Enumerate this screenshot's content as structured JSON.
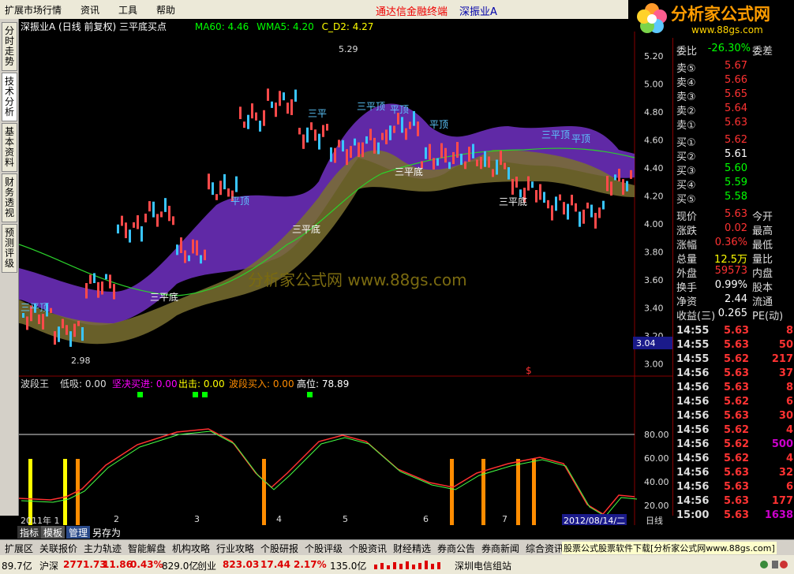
{
  "menubar": {
    "items": [
      "扩展市场行情",
      "资讯",
      "工具",
      "帮助"
    ],
    "highlight1": "通达信金融终端",
    "highlight2": "深振业A"
  },
  "logo": {
    "brand": "分析家公式网",
    "url": "www.88gs.com",
    "sub": "深振业A"
  },
  "sidetabs": [
    "分时走势",
    "技术分析",
    "基本资料",
    "财务透视",
    "预测评级"
  ],
  "chart": {
    "title": "深振业A (日线 前复权) 三平底买点",
    "ma60": "MA60: 4.46",
    "wma5": "WMA5: 4.20",
    "cd2": "C_D2: 4.27",
    "high_label": "5.29",
    "low_label": "2.98",
    "watermark": "分析家公式网 www.88gs.com",
    "labels": [
      "三平顶",
      "平顶",
      "三平底",
      "三平底",
      "三平",
      "平顶",
      "三平顶",
      "平顶",
      "三平底",
      "三平底",
      "三平顶",
      "平顶"
    ],
    "y_axis": [
      "5.20",
      "5.00",
      "4.80",
      "4.60",
      "4.40",
      "4.20",
      "4.00",
      "3.80",
      "3.60",
      "3.40",
      "3.20",
      "3.00"
    ],
    "cursor_price": "3.04",
    "dollar_marker": "$"
  },
  "indicator": {
    "name": "波段王",
    "low": "低吸: 0.00",
    "buy": "坚决买进: 0.00",
    "exit": "出击: 0.00",
    "wave": "波段买入: 0.00",
    "high": "高位: 78.89",
    "y_axis": [
      "80.00",
      "60.00",
      "40.00",
      "20.00"
    ]
  },
  "x_axis": {
    "labels": [
      "2011年 1",
      "2",
      "3",
      "4",
      "5",
      "6",
      "7"
    ],
    "date_badge": "2012/08/14/二",
    "period": "日线"
  },
  "indicator_tabs": [
    "指标",
    "模板",
    "管理",
    "另存为"
  ],
  "quote": {
    "ratio_label": "委比",
    "ratio_value": "-26.30%",
    "ratio_right": "委差",
    "asks": [
      {
        "label": "卖⑤",
        "price": "5.67"
      },
      {
        "label": "卖④",
        "price": "5.66"
      },
      {
        "label": "卖③",
        "price": "5.65"
      },
      {
        "label": "卖②",
        "price": "5.64"
      },
      {
        "label": "卖①",
        "price": "5.63"
      }
    ],
    "bids": [
      {
        "label": "买①",
        "price": "5.62",
        "color": "#ff3232"
      },
      {
        "label": "买②",
        "price": "5.61",
        "color": "#ffffff"
      },
      {
        "label": "买③",
        "price": "5.60",
        "color": "#00ff00"
      },
      {
        "label": "买④",
        "price": "5.59",
        "color": "#00ff00"
      },
      {
        "label": "买⑤",
        "price": "5.58",
        "color": "#00ff00"
      }
    ],
    "stats": [
      {
        "label": "现价",
        "value": "5.63",
        "right": "今开",
        "color": "#ff3232"
      },
      {
        "label": "涨跌",
        "value": "0.02",
        "right": "最高",
        "color": "#ff3232"
      },
      {
        "label": "涨幅",
        "value": "0.36%",
        "right": "最低",
        "color": "#ff3232"
      },
      {
        "label": "总量",
        "value": "12.5万",
        "right": "量比",
        "color": "#ffff00"
      },
      {
        "label": "外盘",
        "value": "59573",
        "right": "内盘",
        "color": "#ff3232"
      },
      {
        "label": "换手",
        "value": "0.99%",
        "right": "股本",
        "color": "#ffffff"
      },
      {
        "label": "净资",
        "value": "2.44",
        "right": "流通",
        "color": "#ffffff"
      },
      {
        "label": "收益(三)",
        "value": "0.265",
        "right": "PE(动)",
        "color": "#ffffff"
      }
    ],
    "ticks": [
      {
        "time": "14:55",
        "price": "5.63",
        "vol": "8",
        "color": "#ff3232"
      },
      {
        "time": "14:55",
        "price": "5.63",
        "vol": "50",
        "color": "#ff3232"
      },
      {
        "time": "14:55",
        "price": "5.62",
        "vol": "217",
        "color": "#ff3232"
      },
      {
        "time": "14:56",
        "price": "5.63",
        "vol": "37",
        "color": "#ff3232"
      },
      {
        "time": "14:56",
        "price": "5.63",
        "vol": "8",
        "color": "#ff3232"
      },
      {
        "time": "14:56",
        "price": "5.62",
        "vol": "6",
        "color": "#ff3232"
      },
      {
        "time": "14:56",
        "price": "5.63",
        "vol": "30",
        "color": "#ff3232"
      },
      {
        "time": "14:56",
        "price": "5.62",
        "vol": "4",
        "color": "#ff3232"
      },
      {
        "time": "14:56",
        "price": "5.62",
        "vol": "500",
        "color": "#cc00cc"
      },
      {
        "time": "14:56",
        "price": "5.62",
        "vol": "4",
        "color": "#ff3232"
      },
      {
        "time": "14:56",
        "price": "5.63",
        "vol": "32",
        "color": "#ff3232"
      },
      {
        "time": "14:56",
        "price": "5.63",
        "vol": "6",
        "color": "#ff3232"
      },
      {
        "time": "14:56",
        "price": "5.63",
        "vol": "177",
        "color": "#ff3232"
      },
      {
        "time": "15:00",
        "price": "5.63",
        "vol": "1638",
        "color": "#cc00cc"
      }
    ]
  },
  "bottomtabs": [
    "扩展区",
    "关联报价",
    "主力轨迹",
    "智能解盘",
    "机构攻略",
    "行业攻略",
    "个股研报",
    "个股评级",
    "个股资讯",
    "财经精选",
    "券商公告",
    "券商新闻",
    "综合资讯"
  ],
  "ad_text": "股票公式股票软件下载[分析家公式网www.88gs.com]",
  "status": {
    "a": "89.7亿",
    "b": "沪深",
    "c": "2771.73",
    "d": "11.86",
    "e": "0.43%",
    "f": "829.0亿",
    "g": "创业",
    "h": "823.03",
    "i": "17.44",
    "j": "2.17%",
    "k": "135.0亿",
    "l": "深圳电信组站"
  }
}
